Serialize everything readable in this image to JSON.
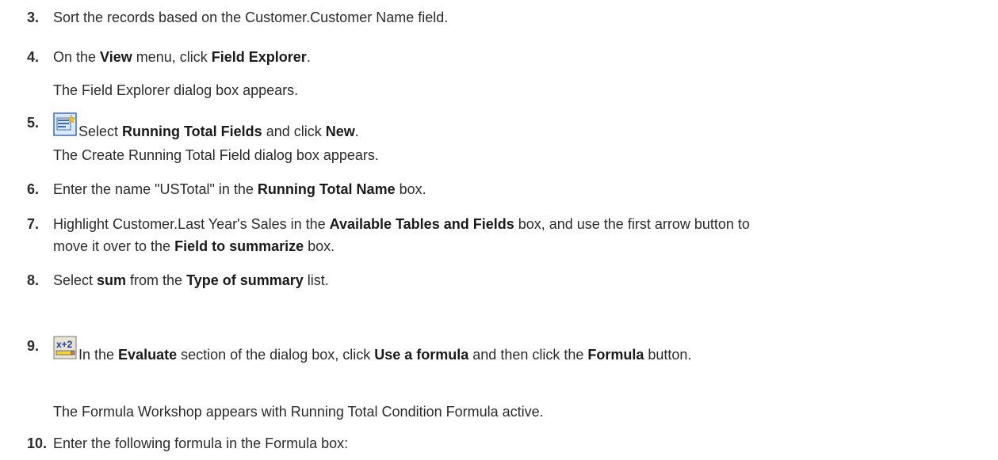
{
  "steps": [
    {
      "num": "3.",
      "parts": [
        {
          "t": "Sort the records based on the Customer.Customer Name field.",
          "b": false
        }
      ]
    },
    {
      "num": "4.",
      "parts": [
        {
          "t": "On the ",
          "b": false
        },
        {
          "t": "View",
          "b": true
        },
        {
          "t": " menu, click ",
          "b": false
        },
        {
          "t": "Field Explorer",
          "b": true
        },
        {
          "t": ".",
          "b": false
        }
      ]
    },
    {
      "num": "5.",
      "icon": "new-field-icon",
      "parts": [
        {
          "t": "Select ",
          "b": false
        },
        {
          "t": "Running Total Fields",
          "b": true
        },
        {
          "t": " and click ",
          "b": false
        },
        {
          "t": "New",
          "b": true
        },
        {
          "t": ".",
          "b": false
        }
      ]
    },
    {
      "num": "6.",
      "parts": [
        {
          "t": "Enter the name \"USTotal\" in the ",
          "b": false
        },
        {
          "t": "Running Total Name",
          "b": true
        },
        {
          "t": " box.",
          "b": false
        }
      ]
    },
    {
      "num": "7.",
      "parts": [
        {
          "t": "Highlight Customer.Last Year's Sales in the ",
          "b": false
        },
        {
          "t": "Available Tables and Fields",
          "b": true
        },
        {
          "t": " box, and use the first arrow button to",
          "b": false
        }
      ]
    },
    {
      "num": "",
      "parts": [
        {
          "t": "move it over to the ",
          "b": false
        },
        {
          "t": "Field to summarize",
          "b": true
        },
        {
          "t": " box.",
          "b": false
        }
      ]
    },
    {
      "num": "8.",
      "parts": [
        {
          "t": "Select ",
          "b": false
        },
        {
          "t": "sum",
          "b": true
        },
        {
          "t": " from the ",
          "b": false
        },
        {
          "t": "Type of summary",
          "b": true
        },
        {
          "t": " list.",
          "b": false
        }
      ]
    },
    {
      "num": "9.",
      "icon": "formula-icon",
      "parts": [
        {
          "t": "In the ",
          "b": false
        },
        {
          "t": "Evaluate",
          "b": true
        },
        {
          "t": " section of the dialog box, click ",
          "b": false
        },
        {
          "t": "Use a formula",
          "b": true
        },
        {
          "t": " and then click the ",
          "b": false
        },
        {
          "t": "Formula",
          "b": true
        },
        {
          "t": " button.",
          "b": false
        }
      ]
    },
    {
      "num": "10.",
      "parts": [
        {
          "t": "Enter the following formula in the Formula box:",
          "b": false
        }
      ]
    }
  ],
  "notes": [
    "The Field Explorer dialog box appears.",
    "The Create Running Total Field dialog box appears.",
    "The Formula Workshop appears with Running Total Condition Formula active."
  ]
}
